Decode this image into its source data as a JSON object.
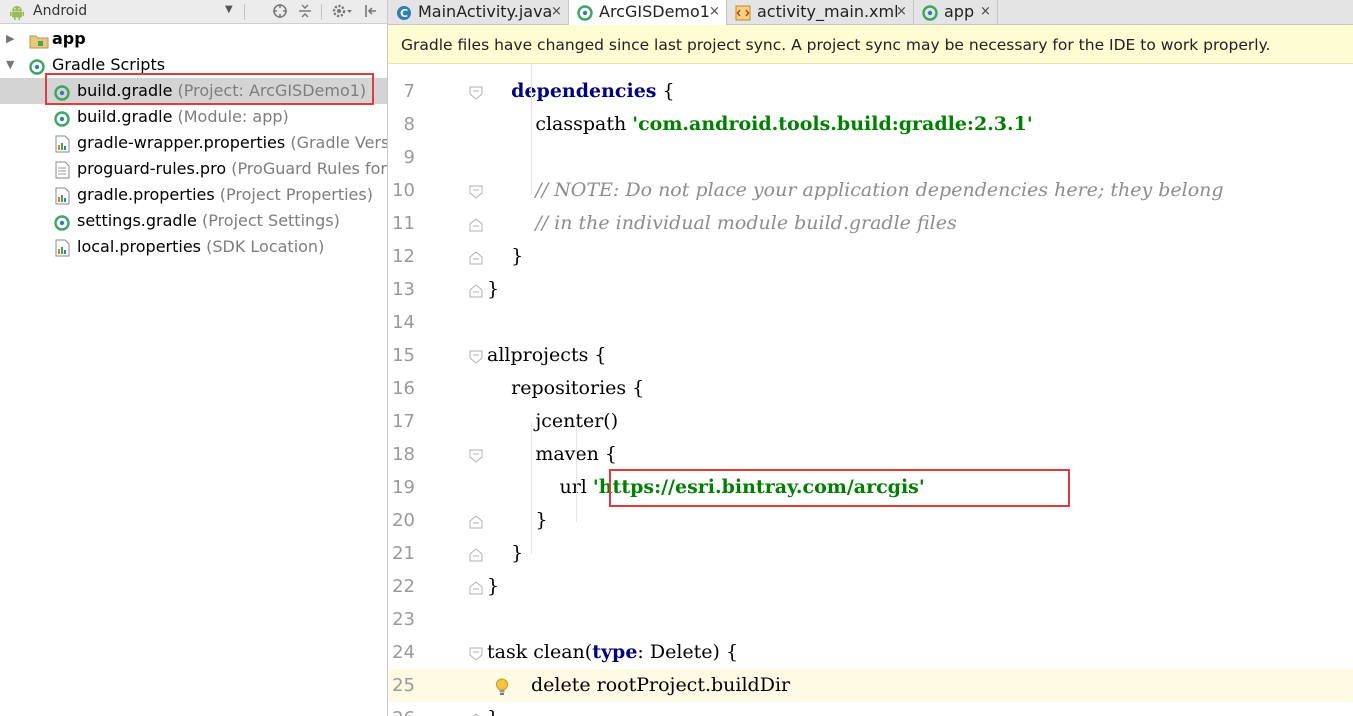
{
  "left_panel": {
    "view_select": "Android",
    "toolbar_icons": [
      "target-icon",
      "collapse-icon",
      "gear-icon",
      "hide-panel-icon"
    ],
    "tree": [
      {
        "label": "app",
        "hint": "",
        "bold": true,
        "icon": "folder-icon",
        "arrow": "collapsed"
      },
      {
        "label": "Gradle Scripts",
        "hint": "",
        "bold": false,
        "icon": "gradle-icon",
        "arrow": "expanded"
      },
      {
        "label": "build.gradle",
        "hint": "(Project: ArcGISDemo1)",
        "bold": false,
        "icon": "gradle-icon",
        "selected": true
      },
      {
        "label": "build.gradle",
        "hint": "(Module: app)",
        "bold": false,
        "icon": "gradle-icon"
      },
      {
        "label": "gradle-wrapper.properties",
        "hint": "(Gradle Versio",
        "bold": false,
        "icon": "properties-icon"
      },
      {
        "label": "proguard-rules.pro",
        "hint": "(ProGuard Rules for a",
        "bold": false,
        "icon": "file-icon"
      },
      {
        "label": "gradle.properties",
        "hint": "(Project Properties)",
        "bold": false,
        "icon": "properties-icon"
      },
      {
        "label": "settings.gradle",
        "hint": "(Project Settings)",
        "bold": false,
        "icon": "gradle-icon"
      },
      {
        "label": "local.properties",
        "hint": "(SDK Location)",
        "bold": false,
        "icon": "properties-icon"
      }
    ]
  },
  "tabs": [
    {
      "label": "MainActivity.java",
      "icon": "java-class-icon",
      "active": false
    },
    {
      "label": "ArcGISDemo1",
      "icon": "gradle-icon",
      "active": true
    },
    {
      "label": "activity_main.xml",
      "icon": "xml-icon",
      "active": false
    },
    {
      "label": "app",
      "icon": "gradle-icon",
      "active": false
    }
  ],
  "tab_close_glyph": "×",
  "notification": "Gradle files have changed since last project sync. A project sync may be necessary for the IDE to work properly.",
  "editor": {
    "lines": [
      {
        "n": "7",
        "code": [
          {
            "t": "    "
          },
          {
            "t": "dependencies",
            "c": "kw"
          },
          {
            "t": " {"
          }
        ]
      },
      {
        "n": "8",
        "code": [
          {
            "t": "        classpath "
          },
          {
            "t": "'com.android.tools.build:gradle:2.3.1'",
            "c": "str"
          }
        ]
      },
      {
        "n": "9",
        "code": []
      },
      {
        "n": "10",
        "code": [
          {
            "t": "        "
          },
          {
            "t": "// NOTE: Do not place your application dependencies here; they belong",
            "c": "cmt"
          }
        ]
      },
      {
        "n": "11",
        "code": [
          {
            "t": "        "
          },
          {
            "t": "// in the individual module build.gradle files",
            "c": "cmt"
          }
        ]
      },
      {
        "n": "12",
        "code": [
          {
            "t": "    }"
          }
        ]
      },
      {
        "n": "13",
        "code": [
          {
            "t": "}"
          }
        ]
      },
      {
        "n": "14",
        "code": []
      },
      {
        "n": "15",
        "code": [
          {
            "t": "allprojects {"
          }
        ]
      },
      {
        "n": "16",
        "code": [
          {
            "t": "    repositories {"
          }
        ]
      },
      {
        "n": "17",
        "code": [
          {
            "t": "        jcenter()"
          }
        ]
      },
      {
        "n": "18",
        "code": [
          {
            "t": "        maven {"
          }
        ]
      },
      {
        "n": "19",
        "code": [
          {
            "t": "            url "
          },
          {
            "t": "'https://esri.bintray.com/arcgis'",
            "c": "str"
          }
        ]
      },
      {
        "n": "20",
        "code": [
          {
            "t": "        }"
          }
        ]
      },
      {
        "n": "21",
        "code": [
          {
            "t": "    }"
          }
        ]
      },
      {
        "n": "22",
        "code": [
          {
            "t": "}"
          }
        ]
      },
      {
        "n": "23",
        "code": []
      },
      {
        "n": "24",
        "code": [
          {
            "t": "task clean("
          },
          {
            "t": "type",
            "c": "kw"
          },
          {
            "t": ": Delete) {"
          }
        ]
      },
      {
        "n": "25",
        "code": [
          {
            "t": "    delete rootProject.buildDir"
          }
        ],
        "caret": true
      },
      {
        "n": "26",
        "code": [
          {
            "t": "}"
          }
        ]
      }
    ]
  },
  "colors": {
    "keyword": "#000080",
    "string": "#008000",
    "comment": "#8c8c8c",
    "highlight_box": "#e03c3c",
    "notification_bg": "#fdfcd2",
    "caret_line": "#fffae3"
  }
}
